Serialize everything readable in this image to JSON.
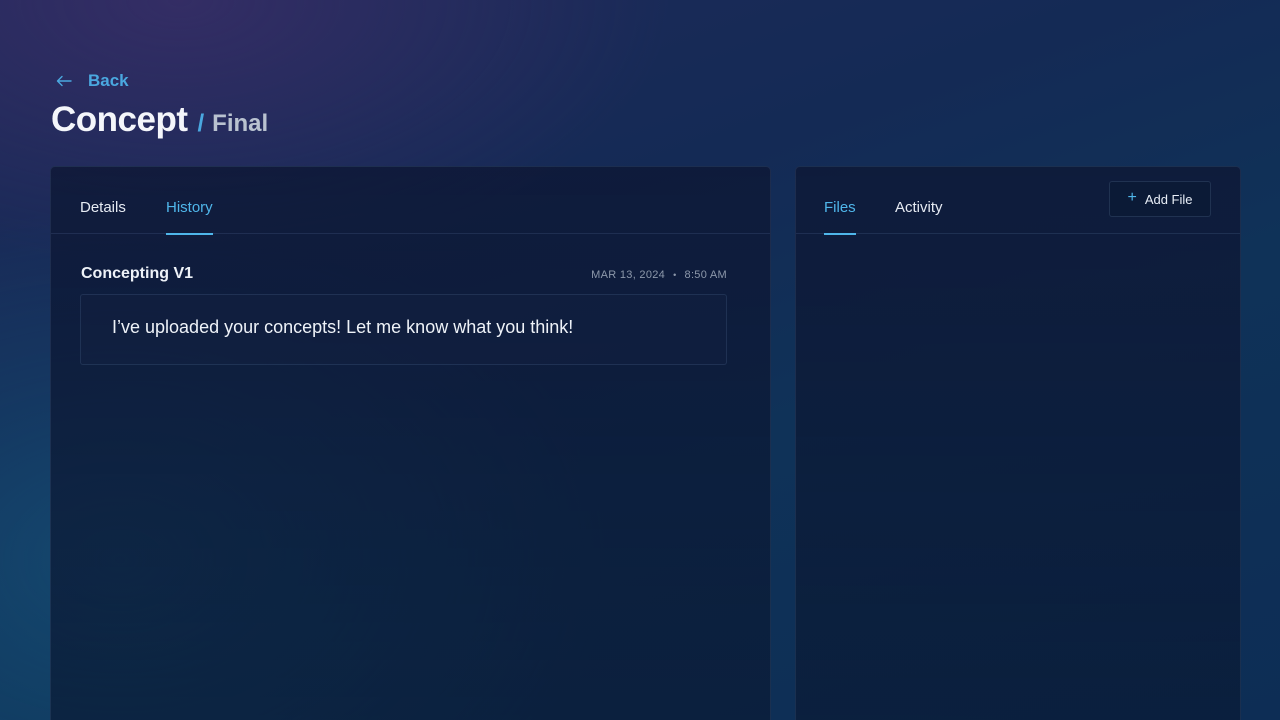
{
  "nav": {
    "back_label": "Back"
  },
  "header": {
    "title": "Concept",
    "separator": "/",
    "subtitle": "Final"
  },
  "left_panel": {
    "tabs": [
      {
        "label": "Details",
        "active": false
      },
      {
        "label": "History",
        "active": true
      }
    ],
    "history_entry": {
      "title": "Concepting V1",
      "date": "MAR 13, 2024",
      "time": "8:50 AM",
      "message": "I’ve uploaded your concepts! Let me know what you think!"
    }
  },
  "right_panel": {
    "tabs": [
      {
        "label": "Files",
        "active": true
      },
      {
        "label": "Activity",
        "active": false
      }
    ],
    "add_file_label": "Add File"
  },
  "colors": {
    "accent": "#4fb6ea",
    "text": "#eef2f8",
    "muted": "#8d98ab"
  },
  "icons": {
    "back": "arrow-left-icon",
    "add": "plus-icon"
  }
}
